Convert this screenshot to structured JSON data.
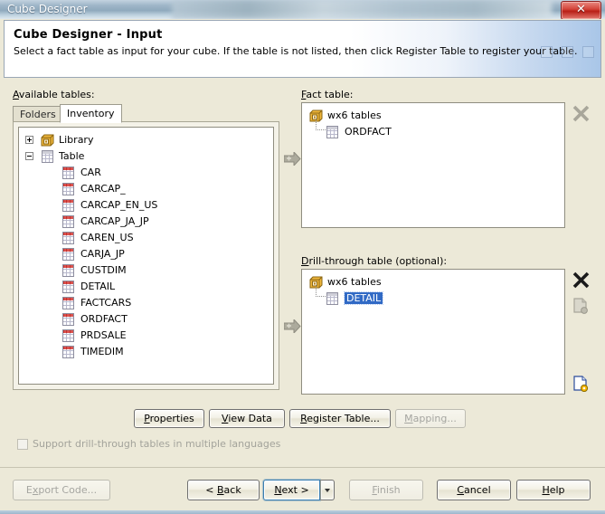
{
  "window": {
    "title": "Cube Designer",
    "close_label": "✕"
  },
  "header": {
    "title": "Cube Designer - Input",
    "subtitle": "Select a fact table as input for your cube. If the table is not listed, then click Register Table to register your table."
  },
  "left": {
    "label": "Available tables:",
    "label_accel": "A",
    "label_rest": "vailable tables:",
    "tabs": [
      {
        "label": "Folders",
        "active": false
      },
      {
        "label": "Inventory",
        "active": true
      }
    ],
    "tree": {
      "nodes": [
        {
          "label": "Library",
          "icon": "library-icon",
          "state": "collapsed",
          "level": 0
        },
        {
          "label": "Table",
          "icon": "table-icon",
          "state": "expanded",
          "level": 0
        }
      ],
      "tables": [
        "CAR",
        "CARCAP_",
        "CARCAP_EN_US",
        "CARCAP_JA_JP",
        "CAREN_US",
        "CARJA_JP",
        "CUSTDIM",
        "DETAIL",
        "FACTCARS",
        "ORDFACT",
        "PRDSALE",
        "TIMEDIM"
      ]
    }
  },
  "fact": {
    "label": "Fact table:",
    "label_accel": "F",
    "label_rest": "act table:",
    "root": "wx6 tables",
    "child": "ORDFACT",
    "child_selected": false,
    "remove_icon": "delete-x-icon",
    "props_icon": "table-properties-icon"
  },
  "drill": {
    "label": "Drill-through table (optional):",
    "label_accel": "D",
    "label_rest": "rill-through table (optional):",
    "root": "wx6 tables",
    "child": "DETAIL",
    "child_selected": true,
    "remove_icon": "delete-x-icon",
    "props_icon": "table-properties-icon"
  },
  "arrows": {
    "fact_arrow": "add-to-fact-arrow-icon",
    "drill_arrow": "add-to-drill-arrow-icon"
  },
  "toolbuttons": [
    {
      "name": "properties-button",
      "accel": "P",
      "rest": "roperties",
      "pre": "",
      "disabled": false
    },
    {
      "name": "view-data-button",
      "accel": "V",
      "rest": "iew Data",
      "pre": "",
      "disabled": false
    },
    {
      "name": "register-table-button",
      "accel": "R",
      "rest": "egister Table...",
      "pre": "",
      "disabled": false
    },
    {
      "name": "mapping-button",
      "accel": "M",
      "rest": "apping...",
      "pre": "",
      "disabled": true
    }
  ],
  "checkbox": {
    "label": "Support drill-through tables in multiple languages",
    "checked": false,
    "disabled": true
  },
  "footer_buttons": [
    {
      "name": "export-code-button",
      "accel": "x",
      "pre": "E",
      "rest": "port Code...",
      "disabled": true,
      "focus": false
    },
    {
      "name": "back-button",
      "accel": "B",
      "pre": "< ",
      "rest": "ack",
      "disabled": false,
      "focus": false
    },
    {
      "name": "next-button",
      "accel": "N",
      "pre": "",
      "rest": "ext >",
      "disabled": false,
      "focus": true
    },
    {
      "name": "finish-button",
      "accel": "F",
      "pre": "",
      "rest": "inish",
      "disabled": true,
      "focus": false
    },
    {
      "name": "cancel-button",
      "accel": "C",
      "pre": "",
      "rest": "ancel",
      "disabled": false,
      "focus": false
    },
    {
      "name": "help-button",
      "accel": "H",
      "pre": "",
      "rest": "elp",
      "disabled": false,
      "focus": false
    }
  ],
  "colors": {
    "dialog_bg": "#ece9d8",
    "selection_blue": "#316ac5",
    "table_icon_red": "#c9302c",
    "focus_blue": "#3c7fb1",
    "close_red": "#c9302c"
  }
}
